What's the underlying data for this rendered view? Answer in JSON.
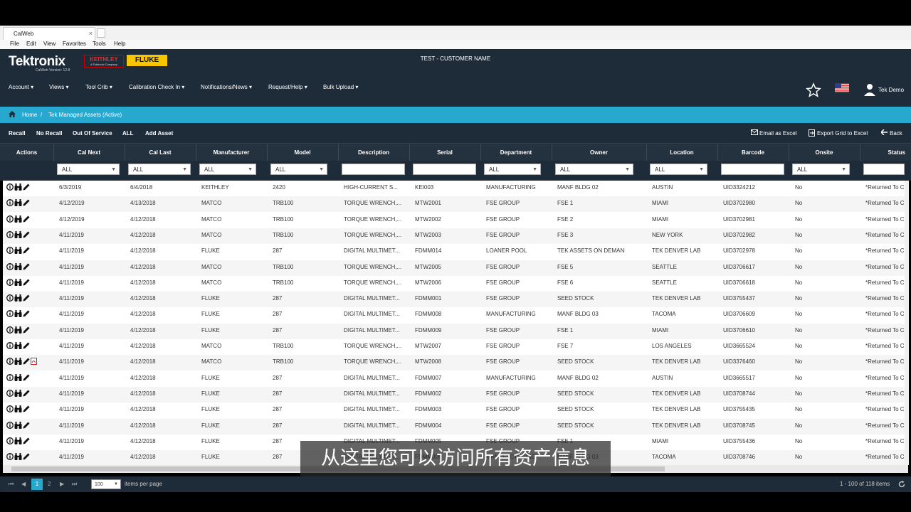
{
  "browser": {
    "tab_title": "CalWeb",
    "tab_close": "×",
    "menu": [
      "File",
      "Edit",
      "View",
      "Favorites",
      "Tools",
      "Help"
    ]
  },
  "header": {
    "logo": "Tektronix",
    "version": "CalWeb Version: 12.8",
    "keithley": "KEITHLEY",
    "keithley_sub": "A Tektronix Company",
    "fluke": "FLUKE",
    "customer": "TEST - CUSTOMER NAME",
    "nav": [
      "Account",
      "Views",
      "Tool Crib",
      "Calibration Check In",
      "Notifications/News",
      "Request/Help",
      "Bulk Upload"
    ],
    "user": "Tek Demo",
    "nav_caret": "▾"
  },
  "breadcrumb": {
    "home": "Home",
    "sep": "/",
    "current": "Tek Managed Assets (Active)"
  },
  "toolbar": {
    "left": [
      "Recall",
      "No Recall",
      "Out Of Service",
      "ALL",
      "Add Asset"
    ],
    "email": "Email as Excel",
    "export": "Export Grid to Excel",
    "back": "Back"
  },
  "grid": {
    "columns": [
      "Actions",
      "Cal Next",
      "Cal Last",
      "Manufacturer",
      "Model",
      "Description",
      "Serial",
      "Department",
      "Owner",
      "Location",
      "Barcode",
      "Onsite",
      "Status"
    ],
    "filter_all": "ALL",
    "rows": [
      {
        "cal_next": "6/3/2019",
        "cal_last": "6/4/2018",
        "mfr": "KEITHLEY",
        "model": "2420",
        "desc": "HIGH-CURRENT S...",
        "serial": "KEI003",
        "dept": "MANUFACTURING",
        "owner": "MANF BLDG 02",
        "loc": "AUSTIN",
        "barcode": "UID3324212",
        "onsite": "No",
        "status": "*Returned To C",
        "pdf": false
      },
      {
        "cal_next": "4/12/2019",
        "cal_last": "4/13/2018",
        "mfr": "MATCO",
        "model": "TRB100",
        "desc": "TORQUE WRENCH,...",
        "serial": "MTW2001",
        "dept": "FSE GROUP",
        "owner": "FSE 1",
        "loc": "MIAMI",
        "barcode": "UID3702980",
        "onsite": "No",
        "status": "*Returned To C",
        "pdf": false
      },
      {
        "cal_next": "4/12/2019",
        "cal_last": "4/12/2018",
        "mfr": "MATCO",
        "model": "TRB100",
        "desc": "TORQUE WRENCH,...",
        "serial": "MTW2002",
        "dept": "FSE GROUP",
        "owner": "FSE 2",
        "loc": "MIAMI",
        "barcode": "UID3702981",
        "onsite": "No",
        "status": "*Returned To C",
        "pdf": false
      },
      {
        "cal_next": "4/11/2019",
        "cal_last": "4/12/2018",
        "mfr": "MATCO",
        "model": "TRB100",
        "desc": "TORQUE WRENCH,...",
        "serial": "MTW2003",
        "dept": "FSE GROUP",
        "owner": "FSE 3",
        "loc": "NEW YORK",
        "barcode": "UID3702982",
        "onsite": "No",
        "status": "*Returned To C",
        "pdf": false
      },
      {
        "cal_next": "4/11/2019",
        "cal_last": "4/12/2018",
        "mfr": "FLUKE",
        "model": "287",
        "desc": "DIGITAL MULTIMET...",
        "serial": "FDMM014",
        "dept": "LOANER POOL",
        "owner": "TEK ASSETS ON DEMAND",
        "loc": "TEK DENVER LAB",
        "barcode": "UID3702978",
        "onsite": "No",
        "status": "*Returned To C",
        "pdf": false
      },
      {
        "cal_next": "4/11/2019",
        "cal_last": "4/12/2018",
        "mfr": "MATCO",
        "model": "TRB100",
        "desc": "TORQUE WRENCH,...",
        "serial": "MTW2005",
        "dept": "FSE GROUP",
        "owner": "FSE 5",
        "loc": "SEATTLE",
        "barcode": "UID3706617",
        "onsite": "No",
        "status": "*Returned To C",
        "pdf": false
      },
      {
        "cal_next": "4/11/2019",
        "cal_last": "4/12/2018",
        "mfr": "MATCO",
        "model": "TRB100",
        "desc": "TORQUE WRENCH,...",
        "serial": "MTW2006",
        "dept": "FSE GROUP",
        "owner": "FSE 6",
        "loc": "SEATTLE",
        "barcode": "UID3706618",
        "onsite": "No",
        "status": "*Returned To C",
        "pdf": false
      },
      {
        "cal_next": "4/11/2019",
        "cal_last": "4/12/2018",
        "mfr": "FLUKE",
        "model": "287",
        "desc": "DIGITAL MULTIMET...",
        "serial": "FDMM001",
        "dept": "FSE GROUP",
        "owner": "SEED STOCK",
        "loc": "TEK DENVER LAB",
        "barcode": "UID3755437",
        "onsite": "No",
        "status": "*Returned To C",
        "pdf": false
      },
      {
        "cal_next": "4/11/2019",
        "cal_last": "4/12/2018",
        "mfr": "FLUKE",
        "model": "287",
        "desc": "DIGITAL MULTIMET...",
        "serial": "FDMM008",
        "dept": "MANUFACTURING",
        "owner": "MANF BLDG 03",
        "loc": "TACOMA",
        "barcode": "UID3706609",
        "onsite": "No",
        "status": "*Returned To C",
        "pdf": false
      },
      {
        "cal_next": "4/11/2019",
        "cal_last": "4/12/2018",
        "mfr": "FLUKE",
        "model": "287",
        "desc": "DIGITAL MULTIMET...",
        "serial": "FDMM009",
        "dept": "FSE GROUP",
        "owner": "FSE 1",
        "loc": "MIAMI",
        "barcode": "UID3706610",
        "onsite": "No",
        "status": "*Returned To C",
        "pdf": false
      },
      {
        "cal_next": "4/11/2019",
        "cal_last": "4/12/2018",
        "mfr": "MATCO",
        "model": "TRB100",
        "desc": "TORQUE WRENCH,...",
        "serial": "MTW2007",
        "dept": "FSE GROUP",
        "owner": "FSE 7",
        "loc": "LOS ANGELES",
        "barcode": "UID3665524",
        "onsite": "No",
        "status": "*Returned To C",
        "pdf": false
      },
      {
        "cal_next": "4/11/2019",
        "cal_last": "4/12/2018",
        "mfr": "MATCO",
        "model": "TRB100",
        "desc": "TORQUE WRENCH,...",
        "serial": "MTW2008",
        "dept": "FSE GROUP",
        "owner": "SEED STOCK",
        "loc": "TEK DENVER LAB",
        "barcode": "UID3376460",
        "onsite": "No",
        "status": "*Returned To C",
        "pdf": true
      },
      {
        "cal_next": "4/11/2019",
        "cal_last": "4/12/2018",
        "mfr": "FLUKE",
        "model": "287",
        "desc": "DIGITAL MULTIMET...",
        "serial": "FDMM007",
        "dept": "MANUFACTURING",
        "owner": "MANF BLDG 02",
        "loc": "AUSTIN",
        "barcode": "UID3665517",
        "onsite": "No",
        "status": "*Returned To C",
        "pdf": false
      },
      {
        "cal_next": "4/11/2019",
        "cal_last": "4/12/2018",
        "mfr": "FLUKE",
        "model": "287",
        "desc": "DIGITAL MULTIMET...",
        "serial": "FDMM002",
        "dept": "FSE GROUP",
        "owner": "SEED STOCK",
        "loc": "TEK DENVER LAB",
        "barcode": "UID3708744",
        "onsite": "No",
        "status": "*Returned To C",
        "pdf": false
      },
      {
        "cal_next": "4/11/2019",
        "cal_last": "4/12/2018",
        "mfr": "FLUKE",
        "model": "287",
        "desc": "DIGITAL MULTIMET...",
        "serial": "FDMM003",
        "dept": "FSE GROUP",
        "owner": "SEED STOCK",
        "loc": "TEK DENVER LAB",
        "barcode": "UID3755435",
        "onsite": "No",
        "status": "*Returned To C",
        "pdf": false
      },
      {
        "cal_next": "4/11/2019",
        "cal_last": "4/12/2018",
        "mfr": "FLUKE",
        "model": "287",
        "desc": "DIGITAL MULTIMET...",
        "serial": "FDMM004",
        "dept": "FSE GROUP",
        "owner": "SEED STOCK",
        "loc": "TEK DENVER LAB",
        "barcode": "UID3708745",
        "onsite": "No",
        "status": "*Returned To C",
        "pdf": false
      },
      {
        "cal_next": "4/11/2019",
        "cal_last": "4/12/2018",
        "mfr": "FLUKE",
        "model": "287",
        "desc": "DIGITAL MULTIMET...",
        "serial": "FDMM005",
        "dept": "FSE GROUP",
        "owner": "FSE 1",
        "loc": "MIAMI",
        "barcode": "UID3755436",
        "onsite": "No",
        "status": "*Returned To C",
        "pdf": false
      },
      {
        "cal_next": "4/11/2019",
        "cal_last": "4/12/2018",
        "mfr": "FLUKE",
        "model": "287",
        "desc": "DIGITAL MULTIMET...",
        "serial": "FDMM006",
        "dept": "MANUFACTURING",
        "owner": "MANF BLDG 03",
        "loc": "TACOMA",
        "barcode": "UID3708746",
        "onsite": "No",
        "status": "*Returned To C",
        "pdf": false
      }
    ]
  },
  "pager": {
    "first": "⏮",
    "prev": "◀",
    "pages": [
      "1",
      "2"
    ],
    "next": "▶",
    "last": "⏭",
    "page_size": "100",
    "page_size_label": "items per page",
    "summary": "1 - 100 of 118 items"
  },
  "subtitle": "从这里您可以访问所有资产信息",
  "colors": {
    "header": "#1e2b38",
    "accent": "#27a8cf",
    "fluke": "#f7c600"
  }
}
